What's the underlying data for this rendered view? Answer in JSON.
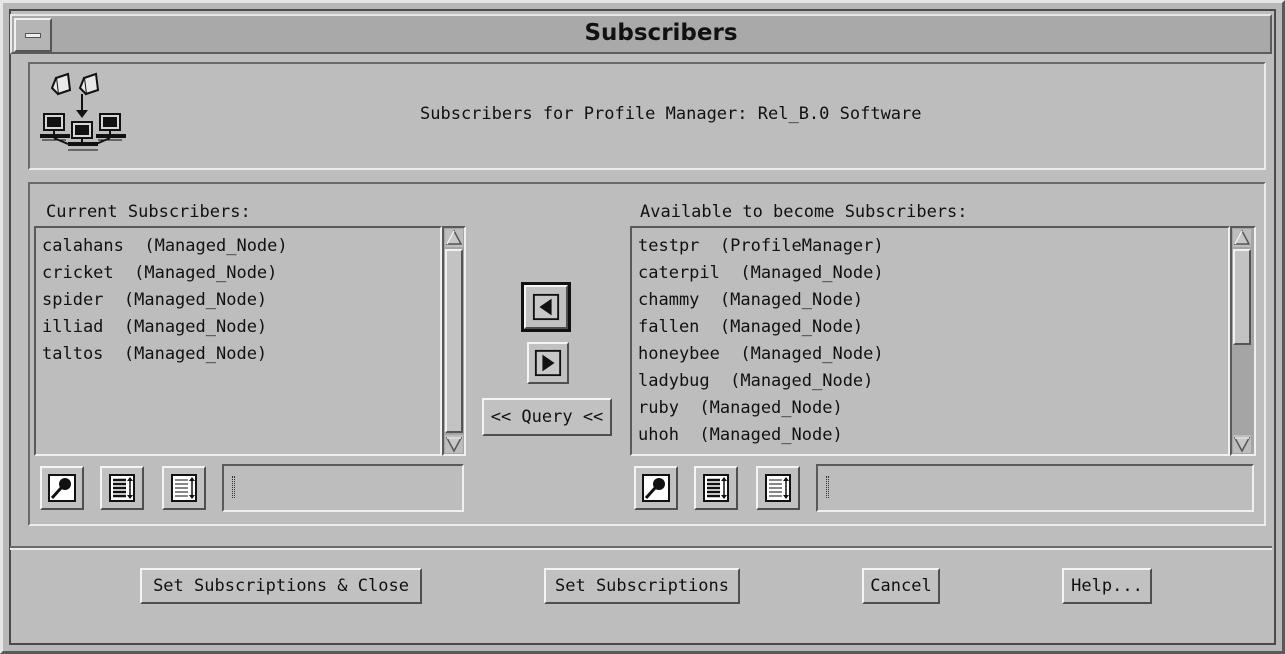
{
  "window": {
    "title": "Subscribers"
  },
  "header": {
    "text": "Subscribers for Profile Manager: Rel_B.0 Software",
    "icon": "subscribers-network-icon"
  },
  "current_subscribers": {
    "label": "Current Subscribers:",
    "items": [
      "calahans  (Managed_Node)",
      "cricket  (Managed_Node)",
      "spider  (Managed_Node)",
      "illiad  (Managed_Node)",
      "taltos  (Managed_Node)"
    ],
    "filter_value": ""
  },
  "available_subscribers": {
    "label": "Available to become Subscribers:",
    "items": [
      "testpr  (ProfileManager)",
      "caterpil  (Managed_Node)",
      "chammy  (Managed_Node)",
      "fallen  (Managed_Node)",
      "honeybee  (Managed_Node)",
      "ladybug  (Managed_Node)",
      "ruby  (Managed_Node)",
      "uhoh  (Managed_Node)"
    ],
    "filter_value": ""
  },
  "middle_controls": {
    "move_left_icon": "arrow-left-icon",
    "move_right_icon": "arrow-right-icon",
    "query_label": "<< Query <<"
  },
  "toolbar_icons": [
    "find-icon",
    "select-all-icon",
    "deselect-all-icon"
  ],
  "buttons": {
    "set_and_close": "Set Subscriptions & Close",
    "set": "Set Subscriptions",
    "cancel": "Cancel",
    "help": "Help..."
  }
}
